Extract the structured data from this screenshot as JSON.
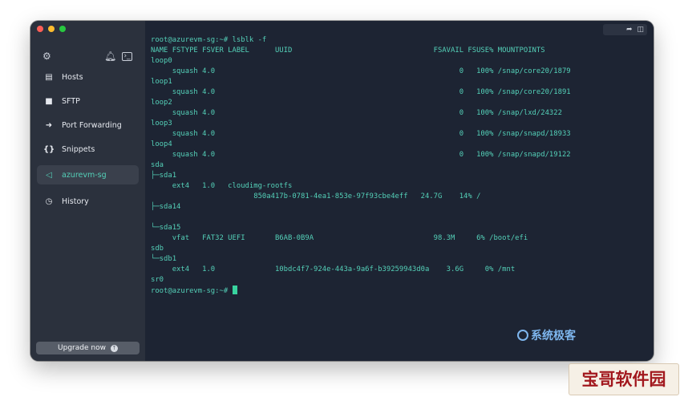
{
  "sidebar": {
    "items": [
      {
        "label": "Hosts",
        "icon": "hosts-icon",
        "glyph": "▤"
      },
      {
        "label": "SFTP",
        "icon": "folder-icon",
        "glyph": "■"
      },
      {
        "label": "Port Forwarding",
        "icon": "forward-arrow-icon",
        "glyph": "➜"
      },
      {
        "label": "Snippets",
        "icon": "braces-icon",
        "glyph": "{}"
      },
      {
        "label": "azurevm-sg",
        "icon": "terminal-icon",
        "glyph": "◁",
        "active": true
      },
      {
        "label": "History",
        "icon": "clock-icon",
        "glyph": "◷"
      }
    ],
    "upgrade_label": "Upgrade now"
  },
  "terminal": {
    "lines": [
      "root@azurevm-sg:~# lsblk -f",
      "NAME FSTYPE FSVER LABEL      UUID                                 FSAVAIL FSUSE% MOUNTPOINTS",
      "loop0",
      "     squash 4.0                                                         0   100% /snap/core20/1879",
      "loop1",
      "     squash 4.0                                                         0   100% /snap/core20/1891",
      "loop2",
      "     squash 4.0                                                         0   100% /snap/lxd/24322",
      "loop3",
      "     squash 4.0                                                         0   100% /snap/snapd/18933",
      "loop4",
      "     squash 4.0                                                         0   100% /snap/snapd/19122",
      "sda",
      "├─sda1",
      "     ext4   1.0   cloudimg-rootfs",
      "                        850a417b-0781-4ea1-853e-97f93cbe4eff   24.7G    14% /",
      "├─sda14",
      "",
      "└─sda15",
      "     vfat   FAT32 UEFI       B6AB-0B9A                            98.3M     6% /boot/efi",
      "sdb",
      "└─sdb1",
      "     ext4   1.0              10bdc4f7-924e-443a-9a6f-b39259943d0a    3.6G     0% /mnt",
      "sr0"
    ],
    "prompt": "root@azurevm-sg:~#"
  },
  "watermarks": {
    "primary": "系统极客",
    "secondary": "宝哥软件园"
  }
}
